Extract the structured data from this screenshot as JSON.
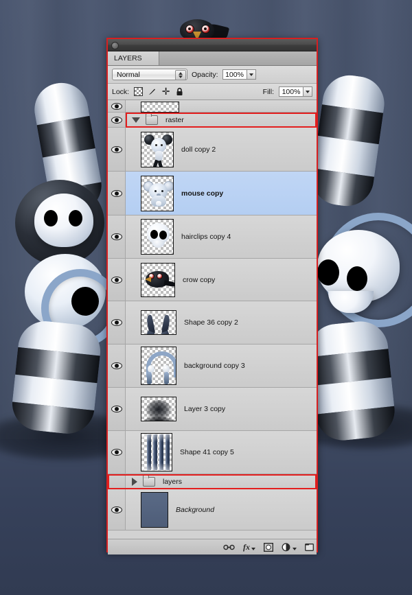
{
  "window": {
    "titlebar_icon": "circle-button",
    "tabs": [
      {
        "label": "LAYERS"
      }
    ]
  },
  "options": {
    "blend_mode": "Normal",
    "blend_mode_options": [
      "Normal"
    ],
    "opacity_label": "Opacity:",
    "opacity_value": "100%",
    "fill_label": "Fill:",
    "fill_value": "100%",
    "lock_label": "Lock:",
    "lock_icons": [
      "transparency-lock-icon",
      "paint-lock-icon",
      "move-lock-icon",
      "all-lock-icon"
    ]
  },
  "layers": [
    {
      "name": "",
      "type": "layer",
      "visible": true,
      "selected": false,
      "partial": true,
      "art": "partial",
      "height": 18
    },
    {
      "name": "raster",
      "type": "group",
      "visible": true,
      "selected": false,
      "expanded": true,
      "highlight": true,
      "height": 22
    },
    {
      "name": "doll copy 2",
      "type": "layer",
      "visible": true,
      "selected": false,
      "art": "doll",
      "height": 64
    },
    {
      "name": "mouse copy",
      "type": "layer",
      "visible": true,
      "selected": true,
      "art": "mouse",
      "height": 64
    },
    {
      "name": "hairclips copy 4",
      "type": "layer",
      "visible": true,
      "selected": false,
      "art": "skull",
      "height": 63
    },
    {
      "name": "crow copy",
      "type": "layer",
      "visible": true,
      "selected": false,
      "art": "crow",
      "height": 62
    },
    {
      "name": "Shape 36 copy 2",
      "type": "layer",
      "visible": true,
      "selected": false,
      "art": "horns",
      "height": 63
    },
    {
      "name": "background copy 3",
      "type": "layer",
      "visible": true,
      "selected": false,
      "art": "bgarc",
      "height": 63
    },
    {
      "name": "Layer 3 copy",
      "type": "layer",
      "visible": true,
      "selected": false,
      "art": "blur",
      "height": 63
    },
    {
      "name": "Shape 41 copy 5",
      "type": "layer",
      "visible": true,
      "selected": false,
      "art": "stripes",
      "height": 63
    },
    {
      "name": "layers",
      "type": "group",
      "visible": false,
      "selected": false,
      "expanded": false,
      "highlight": true,
      "height": 22
    },
    {
      "name": "Background",
      "type": "layer",
      "visible": true,
      "selected": false,
      "art": "solid",
      "italic": true,
      "height": 60
    }
  ],
  "footer": {
    "icons": [
      "link-layers-icon",
      "layer-style-fx-icon",
      "layer-mask-icon",
      "adjustment-layer-icon",
      "new-group-icon"
    ],
    "fx_label": "fx"
  },
  "annotations": {
    "outer_border_color": "#d81f20",
    "group_highlight_color": "#e31d1d",
    "selected_row_color": "#b4cef2"
  }
}
